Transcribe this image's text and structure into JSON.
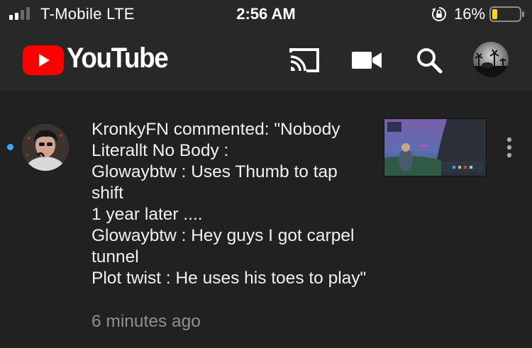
{
  "status_bar": {
    "carrier": "T-Mobile  LTE",
    "time": "2:56 AM",
    "battery": "16%",
    "icons": [
      "signal-icon",
      "orientation-lock-icon",
      "battery-icon"
    ]
  },
  "app_bar": {
    "brand": "YouTube",
    "colors": {
      "brand_red": "#ff0000",
      "background": "#282828"
    },
    "icons": [
      "youtube-logo-icon",
      "cast-icon",
      "camera-icon",
      "search-icon",
      "account-avatar"
    ]
  },
  "notification": {
    "comment": "KronkyFN commented: \"Nobody Literallt No Body :\nGlowaybtw : Uses Thumb to tap shift\n1 year later ....\nGlowaybtw : Hey guys I got carpel tunnel\nPlot twist : He uses his toes to play\"",
    "time_ago": "6 minutes ago",
    "unread_color": "#3ea6ff",
    "icons": [
      "commenter-avatar",
      "video-thumbnail",
      "more-vertical-icon"
    ]
  }
}
